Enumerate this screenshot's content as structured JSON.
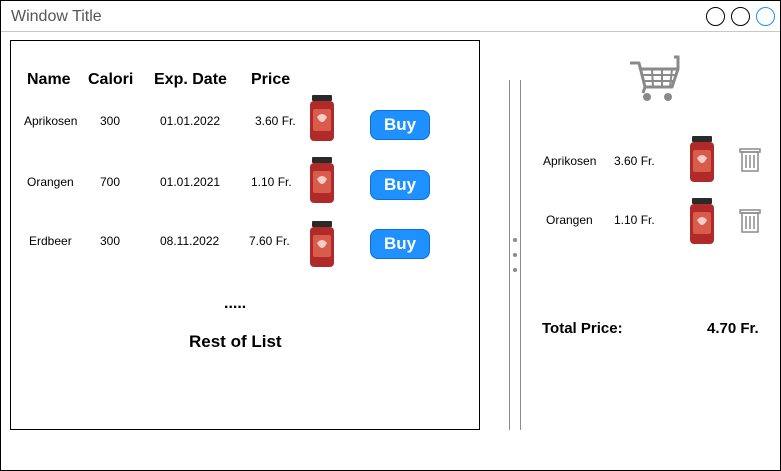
{
  "window": {
    "title": "Window Title"
  },
  "list": {
    "headers": {
      "name": "Name",
      "calori": "Calori",
      "exp_date": "Exp. Date",
      "price": "Price"
    },
    "rows": [
      {
        "name": "Aprikosen",
        "calori": "300",
        "exp_date": "01.01.2022",
        "price": "3.60 Fr.",
        "buy_label": "Buy"
      },
      {
        "name": "Orangen",
        "calori": "700",
        "exp_date": "01.01.2021",
        "price": "1.10 Fr.",
        "buy_label": "Buy"
      },
      {
        "name": "Erdbeer",
        "calori": "300",
        "exp_date": "08.11.2022",
        "price": "7.60 Fr.",
        "buy_label": "Buy"
      }
    ],
    "ellipsis": ".....",
    "rest_label": "Rest of List"
  },
  "cart": {
    "icon": "shopping-cart-icon",
    "items": [
      {
        "name": "Aprikosen",
        "price": "3.60 Fr."
      },
      {
        "name": "Orangen",
        "price": "1.10 Fr."
      }
    ],
    "total_label": "Total Price:",
    "total_value": "4.70 Fr."
  },
  "colors": {
    "buy_button": "#1e90ff",
    "jar_red": "#b02a2a",
    "icon_gray": "#8a8a8a"
  }
}
